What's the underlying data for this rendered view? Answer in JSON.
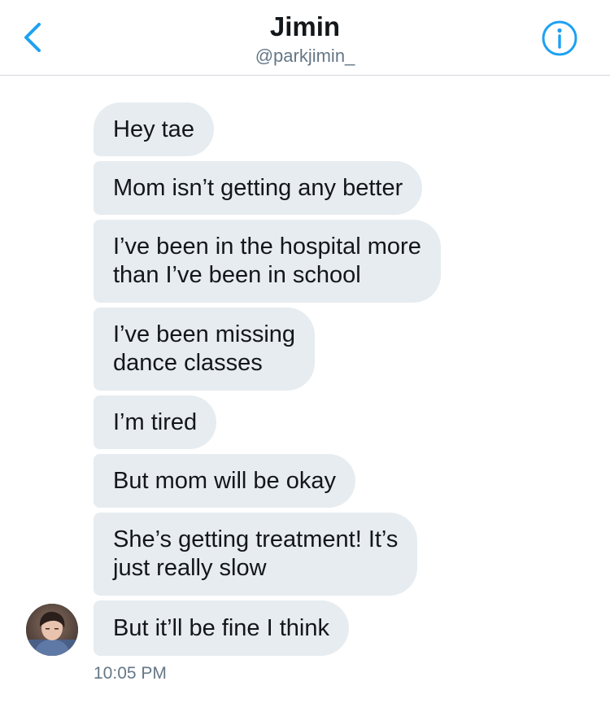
{
  "header": {
    "title": "Jimin",
    "handle": "@parkjimin_",
    "back_icon": "chevron-left-icon",
    "info_icon": "info-icon",
    "accent_color": "#1da1f2"
  },
  "messages": [
    {
      "text": "Hey tae"
    },
    {
      "text": "Mom isn’t getting any better"
    },
    {
      "text": "I’ve been in the hospital more\nthan I’ve been in school"
    },
    {
      "text": "I’ve been missing\ndance classes"
    },
    {
      "text": "I’m tired"
    },
    {
      "text": "But mom will be okay"
    },
    {
      "text": "She’s getting treatment! It’s\njust really slow"
    },
    {
      "text": "But it’ll be fine I think"
    }
  ],
  "timestamp": "10:05 PM",
  "colors": {
    "bubble_bg": "#e6ecf0",
    "text": "#14171a",
    "secondary_text": "#657786",
    "divider": "#d3d6da"
  }
}
